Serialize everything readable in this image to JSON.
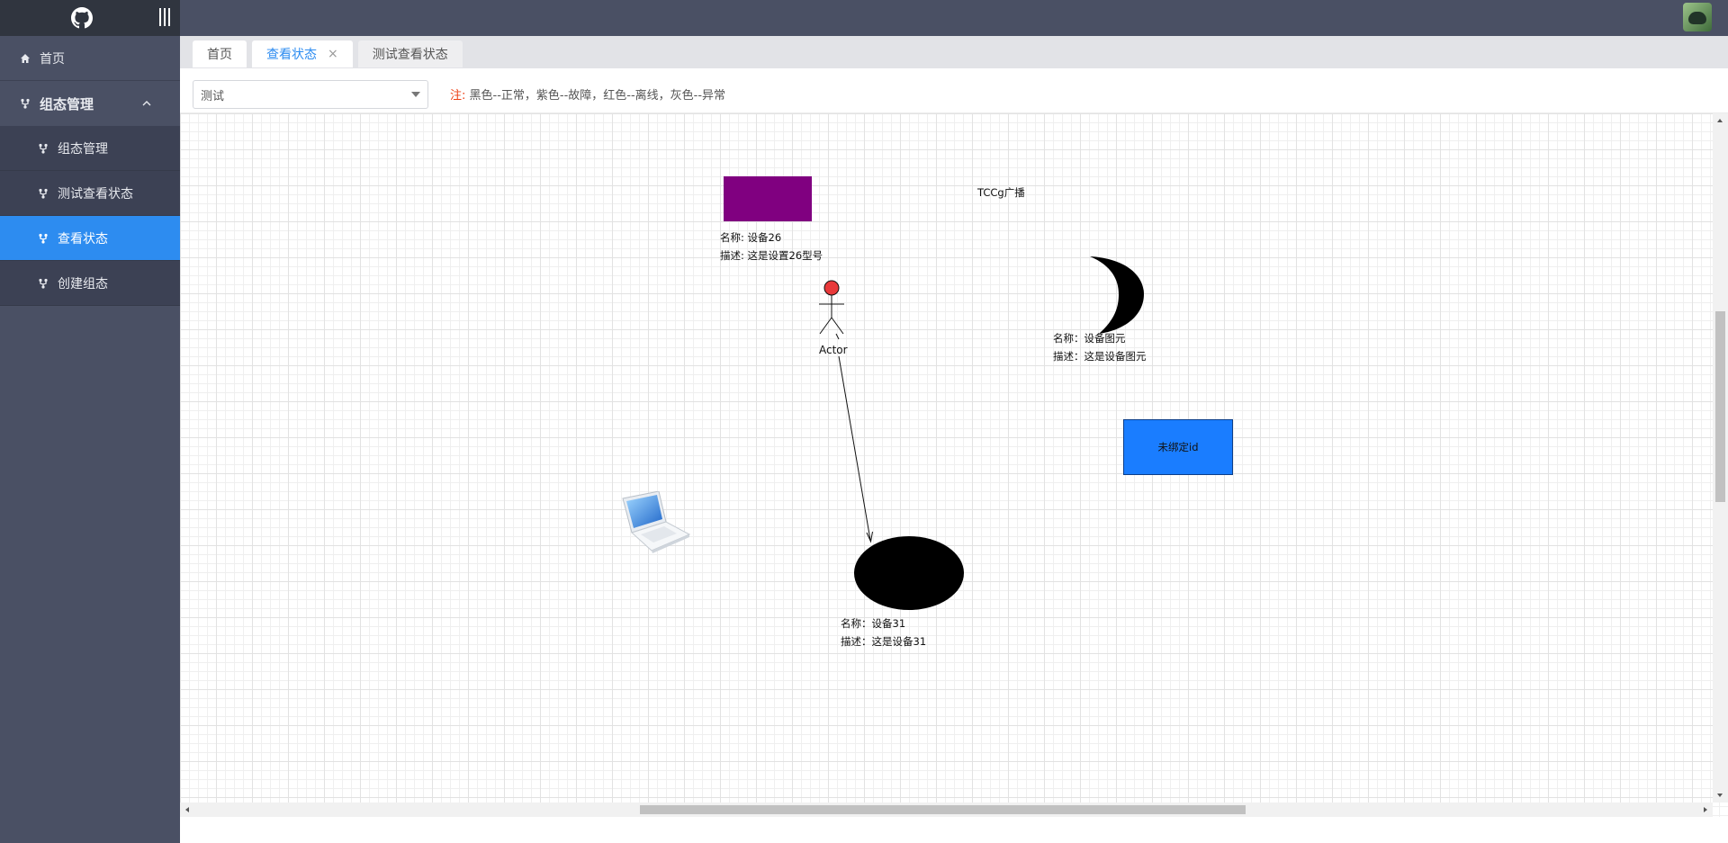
{
  "sidebar": {
    "home_label": "首页",
    "group_label": "组态管理",
    "items": [
      {
        "label": "组态管理",
        "active": false
      },
      {
        "label": "测试查看状态",
        "active": false
      },
      {
        "label": "查看状态",
        "active": true
      },
      {
        "label": "创建组态",
        "active": false
      }
    ]
  },
  "tabs": [
    {
      "label": "首页",
      "active": false,
      "closable": false
    },
    {
      "label": "查看状态",
      "active": true,
      "closable": true,
      "close_glyph": "×"
    },
    {
      "label": "测试查看状态",
      "active": false,
      "closable": false
    }
  ],
  "toolbar": {
    "select_value": "测试",
    "note_label": "注:",
    "note_text": "黑色--正常，紫色--故障，红色--离线，灰色--异常"
  },
  "canvas": {
    "text_broadcast": "TCCg广播",
    "device26": {
      "name_line": "名称: 设备26",
      "desc_line": "描述: 这是设置26型号",
      "color": "#800080"
    },
    "actor": {
      "label": "Actor",
      "head_color": "#e8393a"
    },
    "moon_device": {
      "name_line": "名称：设备图元",
      "desc_line": "描述：这是设备图元"
    },
    "unbound": {
      "label": "未绑定id",
      "color": "#1a7dff"
    },
    "device31": {
      "name_line": "名称：设备31",
      "desc_line": "描述：这是设备31"
    }
  },
  "colors": {
    "sidebar_bg": "#4a5064",
    "logo_bg": "#30353f",
    "accent": "#2d8cf0",
    "note_red": "#ed3f14"
  },
  "icons": {
    "logo": "github-icon",
    "menu_toggle": "menu-bars-icon",
    "home": "home-icon",
    "group": "fork-icon",
    "chevron": "chevron-up-icon"
  }
}
